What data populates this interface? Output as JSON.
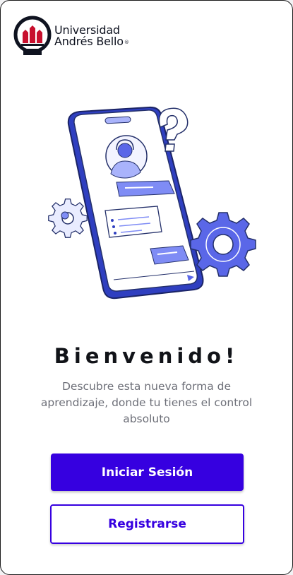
{
  "brand": {
    "line1": "Universidad",
    "line2": "Andrés Bello",
    "reg_mark": "®",
    "primary_color": "#3600e0",
    "logo_red": "#c8102e"
  },
  "welcome": {
    "title": "Bienvenido!",
    "subtitle": "Descubre esta nueva forma de aprendizaje, donde tu tienes el control absoluto"
  },
  "actions": {
    "login_label": "Iniciar Sesión",
    "register_label": "Registrarse"
  },
  "illustration": {
    "icons": [
      "phone-icon",
      "question-mark-icon",
      "support-agent-icon",
      "chat-bubble-icon",
      "gear-icon",
      "send-icon"
    ]
  }
}
